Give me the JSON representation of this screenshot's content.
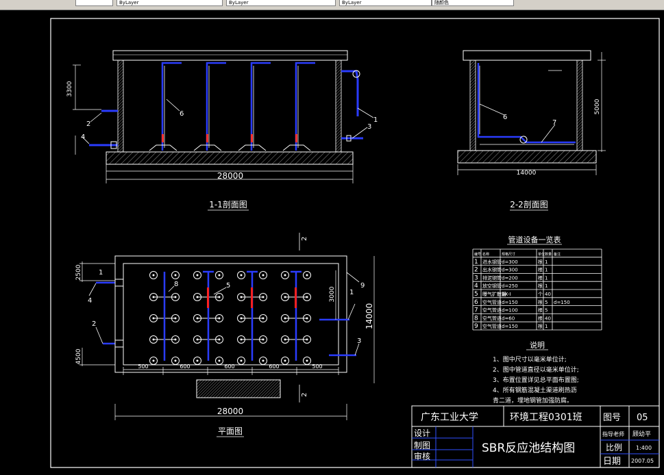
{
  "toolbar": {
    "layer1": "ByLayer",
    "layer2": "ByLayer",
    "layer3": "ByLayer",
    "layer4": "随颜色"
  },
  "views": {
    "section11": {
      "title": "1-1剖面图",
      "length_dim": "28000",
      "depth_dim": "3300",
      "callouts": [
        "1",
        "2",
        "3",
        "4",
        "6"
      ]
    },
    "section22": {
      "title": "2-2剖面图",
      "width_dim": "14000",
      "height_dim": "5000",
      "callouts": [
        "6",
        "7"
      ]
    },
    "plan": {
      "title": "平面图",
      "length_dim": "28000",
      "width_dim": "14000",
      "dims": [
        "2500",
        "4500",
        "3000",
        "500",
        "600",
        "600",
        "600",
        "500"
      ],
      "callouts": [
        "1",
        "2",
        "3",
        "4",
        "5",
        "8",
        "9",
        "1"
      ],
      "section_marks": [
        "2",
        "2"
      ]
    }
  },
  "equipment_table": {
    "title": "管道设备一览表",
    "headers": [
      "编号",
      "名称",
      "规格尺寸",
      "单位",
      "数量",
      "备注"
    ],
    "rows": [
      [
        "1",
        "进水钢管",
        "d=300",
        "根",
        "1",
        ""
      ],
      [
        "2",
        "出水钢管",
        "d=300",
        "根",
        "1",
        ""
      ],
      [
        "3",
        "排泥钢管",
        "d=200",
        "根",
        "1",
        ""
      ],
      [
        "4",
        "放空钢管",
        "d=250",
        "根",
        "1",
        ""
      ],
      [
        "5",
        "曝气扩散器",
        "SX-I",
        "个",
        "40",
        ""
      ],
      [
        "6",
        "空气管道",
        "d=150",
        "根",
        "5",
        "d=150"
      ],
      [
        "7",
        "空气管道",
        "d=100",
        "根",
        "5",
        ""
      ],
      [
        "8",
        "空气管道",
        "d=60",
        "根",
        "40",
        ""
      ],
      [
        "9",
        "空气管道",
        "d=150",
        "根",
        "1",
        ""
      ]
    ]
  },
  "notes": {
    "title": "说明",
    "lines": [
      "1、图中尺寸以毫米单位计;",
      "2、图中管道直径以毫米单位计;",
      "3、布置位置详见总平面布置图;",
      "4、所有钢筋混凝土渠道刷热沥",
      "青二道，埋地钢管加强防腐。"
    ]
  },
  "title_block": {
    "school": "广东工业大学",
    "class": "环境工程0301班",
    "drawing_no_label": "图号",
    "drawing_no": "05",
    "design_label": "设计",
    "draw_label": "制图",
    "review_label": "审核",
    "drawing_title": "SBR反应池结构图",
    "advisor_label": "指导老师",
    "advisor": "顾幼平",
    "scale_label": "比例",
    "scale": "1:400",
    "date_label": "日期",
    "date": "2007.05"
  },
  "colors": {
    "background": "#000000",
    "lines": "#ffffff",
    "pipe": "#2233ff",
    "pipe_accent": "#ff2020",
    "title_block_line": "#3050ff"
  }
}
